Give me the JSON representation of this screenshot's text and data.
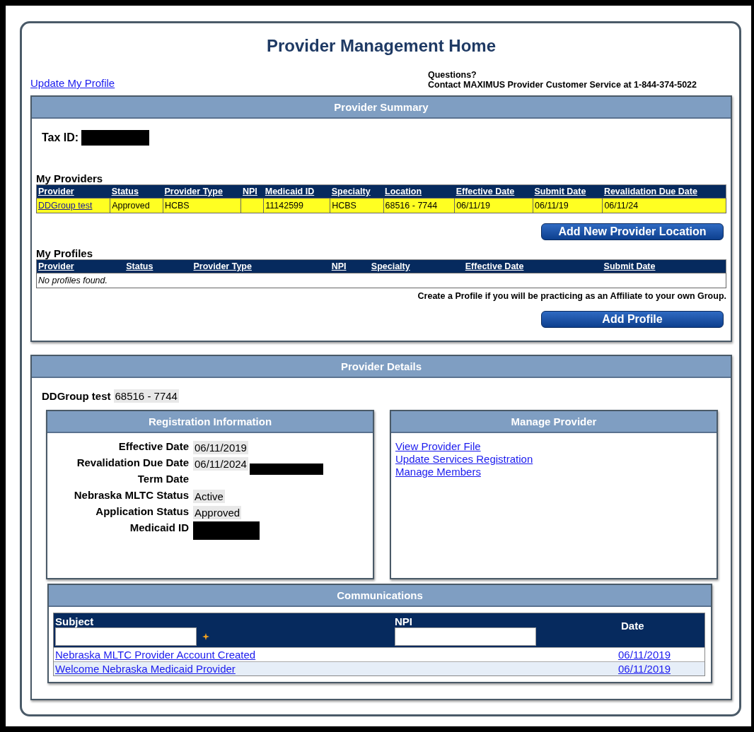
{
  "title": "Provider Management Home",
  "update_profile_link": "Update My Profile",
  "contact": {
    "question": "Questions?",
    "text": "Contact MAXIMUS Provider Customer Service at 1-844-374-5022"
  },
  "provider_summary": {
    "title": "Provider Summary",
    "tax_id": {
      "label": "Tax ID:",
      "redacted": true
    },
    "my_providers": {
      "heading": "My Providers",
      "columns": [
        "Provider",
        "Status",
        "Provider Type",
        "NPI",
        "Medicaid ID",
        "Specialty",
        "Location",
        "Effective Date",
        "Submit Date",
        "Revalidation Due Date"
      ],
      "rows": [
        {
          "highlighted": true,
          "cells": [
            "DDGroup test",
            "Approved",
            "HCBS",
            "",
            "11142599",
            "HCBS",
            "68516 - 7744",
            "06/11/19",
            "06/11/19",
            "06/11/24"
          ]
        }
      ]
    },
    "add_location_button": "Add New Provider Location",
    "my_profiles": {
      "heading": "My Profiles",
      "columns": [
        "Provider",
        "Status",
        "Provider Type",
        "NPI",
        "Specialty",
        "Effective Date",
        "Submit Date"
      ],
      "empty_message": "No profiles found."
    },
    "profile_note": "Create a Profile if you will be practicing as an Affiliate to your own Group.",
    "add_profile_button": "Add Profile"
  },
  "provider_details": {
    "title": "Provider Details",
    "name": "DDGroup test",
    "location": "68516 - 7744",
    "registration": {
      "title": "Registration Information",
      "fields": [
        {
          "label": "Effective Date",
          "value": "06/11/2019"
        },
        {
          "label": "Revalidation Due Date",
          "value": "06/11/2024",
          "redacted": true
        },
        {
          "label": "Term Date"
        },
        {
          "label": "Nebraska MLTC Status",
          "value": "Active"
        },
        {
          "label": "Application Status",
          "value": "Approved"
        },
        {
          "label": "Medicaid ID",
          "redacted": true
        }
      ]
    },
    "manage": {
      "title": "Manage Provider",
      "links": [
        "View Provider File",
        "Update Services Registration",
        "Manage Members"
      ]
    },
    "communications": {
      "title": "Communications",
      "columns": {
        "subject": "Subject",
        "npi": "NPI",
        "date": "Date"
      },
      "rows": [
        {
          "subject": "Nebraska MLTC Provider Account Created",
          "date": "06/11/2019"
        },
        {
          "subject": "Welcome Nebraska Medicaid Provider",
          "date": "06/11/2019"
        }
      ]
    }
  }
}
